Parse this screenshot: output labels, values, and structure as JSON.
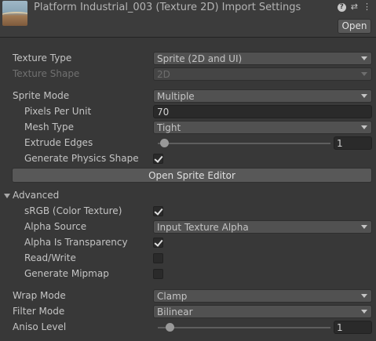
{
  "header": {
    "title": "Platform Industrial_003 (Texture 2D) Import Settings",
    "open_label": "Open",
    "icons": [
      "help-icon",
      "preset-icon",
      "more-menu-icon"
    ]
  },
  "texture_type": {
    "label": "Texture Type",
    "value": "Sprite (2D and UI)"
  },
  "texture_shape": {
    "label": "Texture Shape",
    "value": "2D"
  },
  "sprite_mode": {
    "label": "Sprite Mode",
    "value": "Multiple"
  },
  "pixels_per_unit": {
    "label": "Pixels Per Unit",
    "value": "70"
  },
  "mesh_type": {
    "label": "Mesh Type",
    "value": "Tight"
  },
  "extrude_edges": {
    "label": "Extrude Edges",
    "value": "1",
    "fraction": 0.03
  },
  "generate_physics_shape": {
    "label": "Generate Physics Shape",
    "checked": true
  },
  "open_sprite_editor": {
    "label": "Open Sprite Editor"
  },
  "advanced": {
    "label": "Advanced",
    "srgb": {
      "label": "sRGB (Color Texture)",
      "checked": true
    },
    "alpha_source": {
      "label": "Alpha Source",
      "value": "Input Texture Alpha"
    },
    "alpha_is_transparency": {
      "label": "Alpha Is Transparency",
      "checked": true
    },
    "read_write": {
      "label": "Read/Write",
      "checked": false
    },
    "generate_mipmap": {
      "label": "Generate Mipmap",
      "checked": false
    }
  },
  "wrap_mode": {
    "label": "Wrap Mode",
    "value": "Clamp"
  },
  "filter_mode": {
    "label": "Filter Mode",
    "value": "Bilinear"
  },
  "aniso_level": {
    "label": "Aniso Level",
    "value": "1",
    "fraction": 0.06
  }
}
